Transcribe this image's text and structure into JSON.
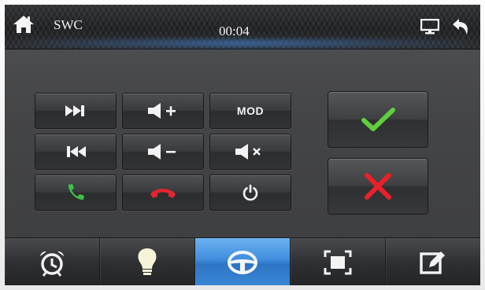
{
  "header": {
    "title": "SWC",
    "time": "00:04",
    "icons": [
      "home-icon",
      "screen-icon",
      "back-arrow-icon"
    ]
  },
  "keys": {
    "rows": [
      [
        "next-track-icon",
        "volume-up-icon",
        "mod"
      ],
      [
        "previous-track-icon",
        "volume-down-icon",
        "mute-icon"
      ],
      [
        "answer-call-icon",
        "hang-up-icon",
        "power-icon"
      ]
    ],
    "mod_label": "MOD"
  },
  "actions": {
    "confirm_icon": "checkmark-icon",
    "cancel_icon": "cross-icon"
  },
  "dock": {
    "items": [
      {
        "icon": "alarm-clock-icon"
      },
      {
        "icon": "light-bulb-icon"
      },
      {
        "icon": "steering-wheel-icon",
        "active": true
      },
      {
        "icon": "screen-fit-icon"
      },
      {
        "icon": "edit-icon"
      }
    ]
  },
  "colors": {
    "confirm": "#5fcf3c",
    "cancel": "#e8212b",
    "answer": "#3fbf4a",
    "hangup": "#e2262e",
    "active_tab": "#3f8ddb"
  }
}
